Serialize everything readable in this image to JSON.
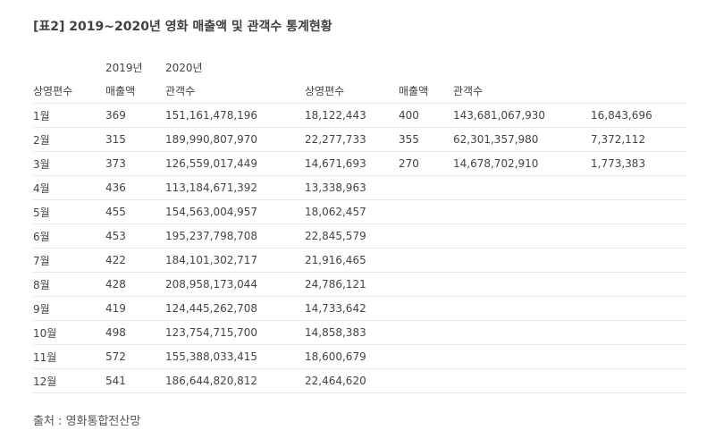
{
  "title": "[표2] 2019~2020년 영화 매출액 및 관객수 통계현황",
  "year_row": [
    "",
    "2019년",
    "2020년",
    "",
    "",
    "",
    ""
  ],
  "header_row": [
    "상영편수",
    "매출액",
    "관객수",
    "상영편수",
    "매출액",
    "관객수",
    ""
  ],
  "rows": [
    [
      "1월",
      "369",
      "151,161,478,196",
      "18,122,443",
      "400",
      "143,681,067,930",
      "16,843,696"
    ],
    [
      "2월",
      "315",
      "189,990,807,970",
      "22,277,733",
      "355",
      "62,301,357,980",
      "7,372,112"
    ],
    [
      "3월",
      "373",
      "126,559,017,449",
      "14,671,693",
      "270",
      "14,678,702,910",
      "1,773,383"
    ],
    [
      "4월",
      "436",
      "113,184,671,392",
      "13,338,963",
      "",
      "",
      ""
    ],
    [
      "5월",
      "455",
      "154,563,004,957",
      "18,062,457",
      "",
      "",
      ""
    ],
    [
      "6월",
      "453",
      "195,237,798,708",
      "22,845,579",
      "",
      "",
      ""
    ],
    [
      "7월",
      "422",
      "184,101,302,717",
      "21,916,465",
      "",
      "",
      ""
    ],
    [
      "8월",
      "428",
      "208,958,173,044",
      "24,786,121",
      "",
      "",
      ""
    ],
    [
      "9월",
      "419",
      "124,445,262,708",
      "14,733,642",
      "",
      "",
      ""
    ],
    [
      "10월",
      "498",
      "123,754,715,700",
      "14,858,383",
      "",
      "",
      ""
    ],
    [
      "11월",
      "572",
      "155,388,033,415",
      "18,600,679",
      "",
      "",
      ""
    ],
    [
      "12월",
      "541",
      "186,644,820,812",
      "22,464,620",
      "",
      "",
      ""
    ]
  ],
  "source": "출처 : 영화통합전산망"
}
